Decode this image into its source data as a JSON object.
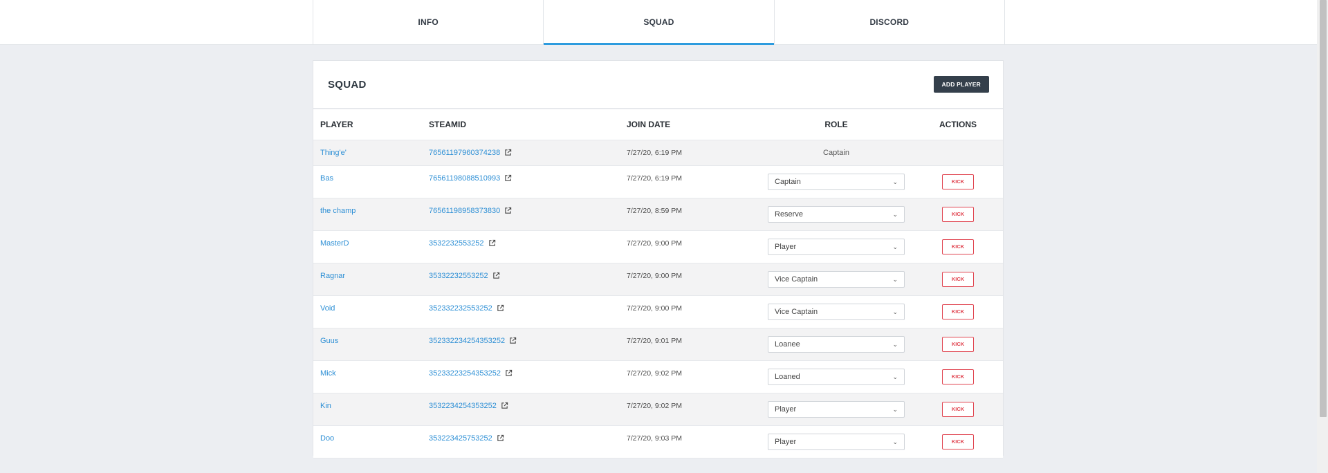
{
  "tabs": [
    {
      "label": "INFO",
      "active": false
    },
    {
      "label": "SQUAD",
      "active": true
    },
    {
      "label": "DISCORD",
      "active": false
    }
  ],
  "squad": {
    "title": "SQUAD",
    "add_button": "ADD PLAYER",
    "columns": [
      "PLAYER",
      "STEAMID",
      "JOIN DATE",
      "ROLE",
      "ACTIONS"
    ],
    "kick_label": "KICK",
    "rows": [
      {
        "player": "Thing'e'",
        "steamid": "76561197960374238",
        "join_date": "7/27/20, 6:19 PM",
        "role": "Captain",
        "editable": false
      },
      {
        "player": "Bas",
        "steamid": "76561198088510993",
        "join_date": "7/27/20, 6:19 PM",
        "role": "Captain",
        "editable": true
      },
      {
        "player": "the champ",
        "steamid": "76561198958373830",
        "join_date": "7/27/20, 8:59 PM",
        "role": "Reserve",
        "editable": true
      },
      {
        "player": "MasterD",
        "steamid": "3532232553252",
        "join_date": "7/27/20, 9:00 PM",
        "role": "Player",
        "editable": true
      },
      {
        "player": "Ragnar",
        "steamid": "35332232553252",
        "join_date": "7/27/20, 9:00 PM",
        "role": "Vice Captain",
        "editable": true
      },
      {
        "player": "Void",
        "steamid": "352332232553252",
        "join_date": "7/27/20, 9:00 PM",
        "role": "Vice Captain",
        "editable": true
      },
      {
        "player": "Guus",
        "steamid": "352332234254353252",
        "join_date": "7/27/20, 9:01 PM",
        "role": "Loanee",
        "editable": true
      },
      {
        "player": "Mick",
        "steamid": "35233223254353252",
        "join_date": "7/27/20, 9:02 PM",
        "role": "Loaned",
        "editable": true
      },
      {
        "player": "Kin",
        "steamid": "3532234254353252",
        "join_date": "7/27/20, 9:02 PM",
        "role": "Player",
        "editable": true
      },
      {
        "player": "Doo",
        "steamid": "353223425753252",
        "join_date": "7/27/20, 9:03 PM",
        "role": "Player",
        "editable": true
      }
    ]
  },
  "colors": {
    "accent": "#2d9bde",
    "link": "#2d8fd5",
    "danger": "#e0424e",
    "dark_button": "#343f4b"
  },
  "icons": {
    "external_link": "external-link-icon",
    "dropdown": "chevron-down-icon"
  }
}
